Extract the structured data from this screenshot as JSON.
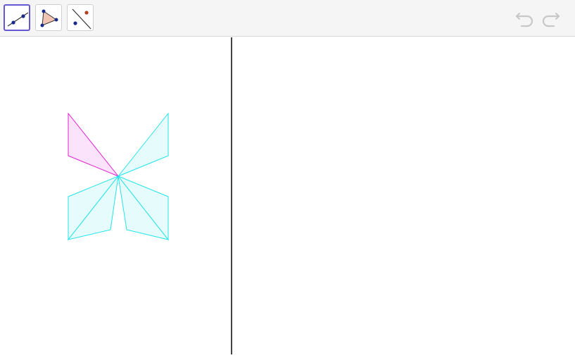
{
  "toolbar": {
    "tools": [
      {
        "name": "line-tool",
        "icon": "line-through-two-points-icon",
        "selected": true
      },
      {
        "name": "polygon-tool",
        "icon": "polygon-icon",
        "selected": false
      },
      {
        "name": "reflect-tool",
        "icon": "reflect-about-line-icon",
        "selected": false
      }
    ],
    "undo_icon": "undo-icon",
    "redo_icon": "redo-icon",
    "selected_border_color": "#6557d2"
  },
  "graphics": {
    "colors": {
      "original_polygon_stroke": "#e020d0",
      "original_polygon_fill": "#fbe4fb",
      "image_polygon_stroke": "#22e4ea",
      "image_polygon_fill": "#e6fbfb",
      "divider": "#444444"
    }
  }
}
